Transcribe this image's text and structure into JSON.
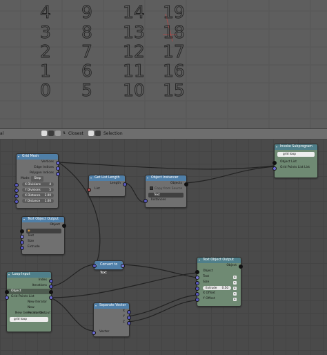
{
  "viewport": {
    "numbers": [
      [
        "4",
        "9",
        "14",
        "19"
      ],
      [
        "3",
        "8",
        "13",
        "18"
      ],
      [
        "2",
        "7",
        "12",
        "17"
      ],
      [
        "1",
        "6",
        "11",
        "16"
      ],
      [
        "0",
        "5",
        "10",
        "15"
      ]
    ]
  },
  "header": {
    "left": "al",
    "closest": "Closest",
    "selection": "Selection"
  },
  "nodes": {
    "grid_mesh": {
      "title": "Grid Mesh",
      "vertices": "Vertices",
      "edge_indices": "Edge Indices",
      "polygon_indices": "Polygon Indices",
      "mode_label": "Mode:",
      "mode_value": "Step",
      "x_div_label": "X Divisions",
      "x_div_value": "4",
      "y_div_label": "Y Divisions",
      "y_div_value": "5",
      "x_dist_label": "X Distance",
      "x_dist_value": "2.00",
      "y_dist_label": "Y Distance",
      "y_dist_value": "1.00"
    },
    "get_list_length": {
      "title": "Get List Length",
      "length": "Length",
      "list": "List"
    },
    "object_instancer": {
      "title": "Object Instancer",
      "objects": "Objects",
      "copy_from_source": "Copy from Source",
      "type": "Text",
      "instances": "Instances"
    },
    "invoke_subprogram": {
      "title": "Invoke Subprogram",
      "program": "grid loop",
      "object_list": "Object List",
      "grid_points_list": "Grid Points List List"
    },
    "text_object_output_1": {
      "title": "Text Object Output",
      "object": "Object",
      "text": "Text",
      "size": "Size",
      "extrude": "Extrude"
    },
    "loop_input": {
      "title": "Loop Input",
      "index": "Index",
      "iterations": "Iterations",
      "object": "Object",
      "grid_points_list": "Grid Points List",
      "new_iterator": "New Iterator",
      "new_parameter": "New Parameter",
      "new_generator_output": "New Generator Output",
      "loop_name": "grid loop"
    },
    "convert_to_text": {
      "title": "Convert to Text"
    },
    "separate_vector": {
      "title": "Separate Vector",
      "x": "X",
      "y": "Y",
      "z": "Z",
      "vector": "Vector"
    },
    "text_object_output_2": {
      "title": "Text Object Output",
      "object_out": "Object",
      "object": "Object",
      "text": "Text",
      "size": "Size",
      "extrude_label": "Extrude",
      "extrude_value": "0.50",
      "x_offset": "X Offset",
      "y_offset": "Y Offset"
    }
  },
  "colors": {
    "node_header": "#4f7fa8",
    "node_body": "#707070",
    "node_green": "#6f8a73",
    "editor_bg": "#4a4a4a",
    "viewport_bg": "#5e5e5e"
  }
}
